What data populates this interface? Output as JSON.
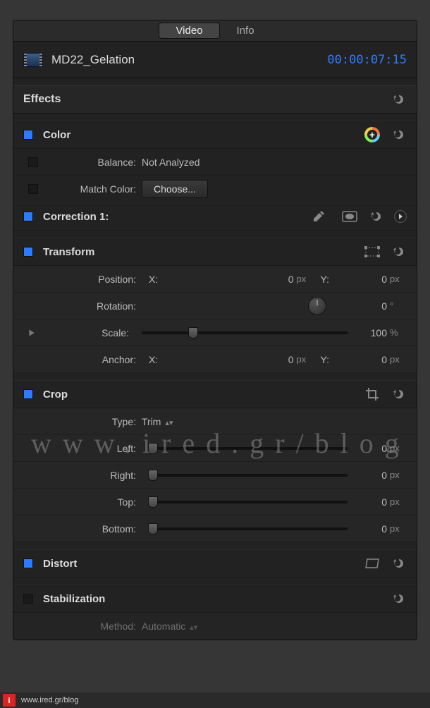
{
  "tabs": {
    "video": "Video",
    "info": "Info"
  },
  "header": {
    "clip_name": "MD22_Gelation",
    "timecode": "00:00:07:15"
  },
  "effects": {
    "title": "Effects"
  },
  "color": {
    "title": "Color",
    "balance_label": "Balance:",
    "balance_value": "Not Analyzed",
    "match_label": "Match Color:",
    "choose_btn": "Choose...",
    "correction_label": "Correction 1:"
  },
  "transform": {
    "title": "Transform",
    "position_label": "Position:",
    "rotation_label": "Rotation:",
    "scale_label": "Scale:",
    "anchor_label": "Anchor:",
    "x_label": "X:",
    "y_label": "Y:",
    "pos_x": "0",
    "pos_y": "0",
    "rotation": "0",
    "scale": "100",
    "anchor_x": "0",
    "anchor_y": "0",
    "px": "px",
    "deg": "°",
    "pct": "%"
  },
  "crop": {
    "title": "Crop",
    "type_label": "Type:",
    "type_value": "Trim",
    "left_label": "Left:",
    "left": "0",
    "right_label": "Right:",
    "right": "0",
    "top_label": "Top:",
    "top": "0",
    "bottom_label": "Bottom:",
    "bottom": "0",
    "px": "px"
  },
  "distort": {
    "title": "Distort"
  },
  "stabilization": {
    "title": "Stabilization",
    "method_label": "Method:",
    "method_value": "Automatic"
  },
  "watermark": "www.ired.gr/blog",
  "footer": {
    "icon": "i",
    "text": "www.ired.gr/blog"
  }
}
